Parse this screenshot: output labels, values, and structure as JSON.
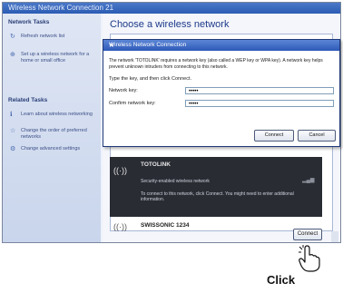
{
  "window": {
    "title": "Wireless Network Connection 21"
  },
  "sidebar": {
    "network_tasks_header": "Network Tasks",
    "network_tasks": [
      {
        "label": "Refresh network list",
        "icon": "refresh-icon"
      },
      {
        "label": "Set up a wireless network for a home or small office",
        "icon": "setup-network-icon"
      }
    ],
    "related_tasks_header": "Related Tasks",
    "related_tasks": [
      {
        "label": "Learn about wireless networking",
        "icon": "info-icon"
      },
      {
        "label": "Change the order of preferred networks",
        "icon": "star-icon"
      },
      {
        "label": "Change advanced settings",
        "icon": "settings-icon"
      }
    ]
  },
  "main": {
    "title": "Choose a wireless network",
    "networks": [
      {
        "name": "TOTOLINK",
        "security": "Security-enabled wireless network",
        "description": "To connect to this network, click Connect. You might need to enter additional information.",
        "icon": "wireless-signal-icon",
        "selected": true
      },
      {
        "name": "SWISSONIC 1234",
        "icon": "wireless-signal-icon",
        "selected": false
      }
    ],
    "connect_label": "Connect"
  },
  "dialog": {
    "title": "Wireless Network Connection",
    "message": "The network 'TOTOLINK' requires a network key (also called a WEP key or WPA key). A network key helps prevent unknown intruders from connecting to this network.",
    "instruction": "Type the key, and then click Connect.",
    "network_key_label": "Network key:",
    "network_key_value": "•••••",
    "confirm_key_label": "Confirm network key:",
    "confirm_key_value": "•••••",
    "connect_label": "Connect",
    "cancel_label": "Cancel"
  },
  "annotation": {
    "click_label": "Click"
  },
  "colors": {
    "accent": "#2b5cb3",
    "selected_row": "#2a2c34",
    "network_name": "#e6e6e6"
  }
}
